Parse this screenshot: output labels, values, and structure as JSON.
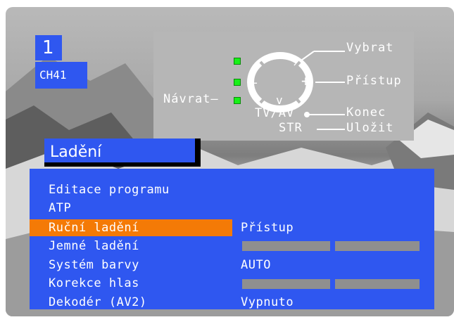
{
  "channel": {
    "number": "1",
    "name": "CH41"
  },
  "help": {
    "select": "Vybrat",
    "access": "Přístup",
    "back": "Návrat–",
    "tvav": "TV/AV",
    "exit": "Konec",
    "str": "STR",
    "save": "Uložit",
    "plus": "+",
    "minus": "–",
    "up": "^",
    "down": "v"
  },
  "menu": {
    "title": "Ladění",
    "items": [
      {
        "label": "Editace programu",
        "value": ""
      },
      {
        "label": "ATP",
        "value": ""
      },
      {
        "label": "Ruční ladění",
        "value": "Přístup",
        "selected": true
      },
      {
        "label": "Jemné ladění",
        "value": ""
      },
      {
        "label": "Systém barvy",
        "value": "AUTO"
      },
      {
        "label": "Korekce hlas",
        "value": ""
      },
      {
        "label": "Dekodér (AV2)",
        "value": "Vypnuto"
      }
    ]
  },
  "colors": {
    "osd_blue": "#2f57f0",
    "highlight": "#f47a06",
    "led": "#18f018",
    "help_panel": "#b6b6b6"
  }
}
